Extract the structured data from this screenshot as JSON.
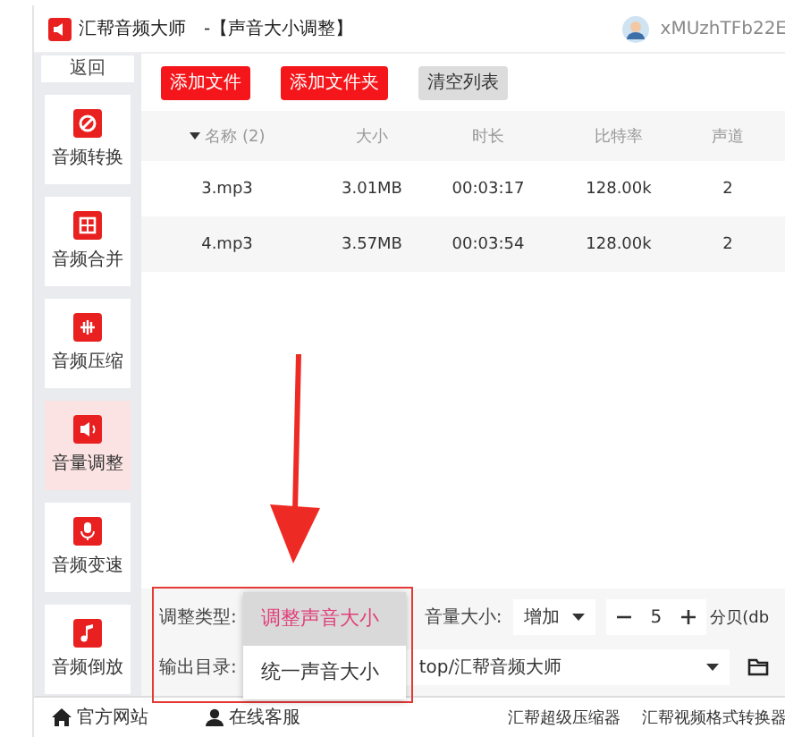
{
  "window": {
    "app_title": "汇帮音频大师",
    "page_title": "-【声音大小调整】",
    "user": "xMUzhTFb22E"
  },
  "sidebar": {
    "back": "返回",
    "items": [
      {
        "label": "音频转换",
        "selected": false
      },
      {
        "label": "音频合并",
        "selected": false
      },
      {
        "label": "音频压缩",
        "selected": false
      },
      {
        "label": "音量调整",
        "selected": true
      },
      {
        "label": "音频变速",
        "selected": false
      },
      {
        "label": "音频倒放",
        "selected": false
      }
    ]
  },
  "toolbar": [
    {
      "label": "添加文件",
      "kind": "primary"
    },
    {
      "label": "添加文件夹",
      "kind": "primary"
    },
    {
      "label": "清空列表",
      "kind": "secondary"
    }
  ],
  "table": {
    "columns": [
      "名称 (2)",
      "大小",
      "时长",
      "比特率",
      "声道"
    ],
    "rows": [
      [
        "3.mp3",
        "3.01MB",
        "00:03:17",
        "128.00k",
        "2"
      ],
      [
        "4.mp3",
        "3.57MB",
        "00:03:54",
        "128.00k",
        "2"
      ]
    ]
  },
  "settings": {
    "type_label": "调整类型:",
    "type_options": [
      {
        "label": "调整声音大小",
        "selected": true
      },
      {
        "label": "统一声音大小",
        "selected": false
      }
    ],
    "volume_label": "音量大小:",
    "volume_mode": "增加",
    "step_value": "5",
    "unit": "分贝(db",
    "output_label": "输出目录:",
    "output_path": "top/汇帮音频大师"
  },
  "footer": {
    "left": [
      "官方网站",
      "在线客服"
    ],
    "right": [
      "汇帮超级压缩器",
      "汇帮视频格式转换器"
    ]
  }
}
